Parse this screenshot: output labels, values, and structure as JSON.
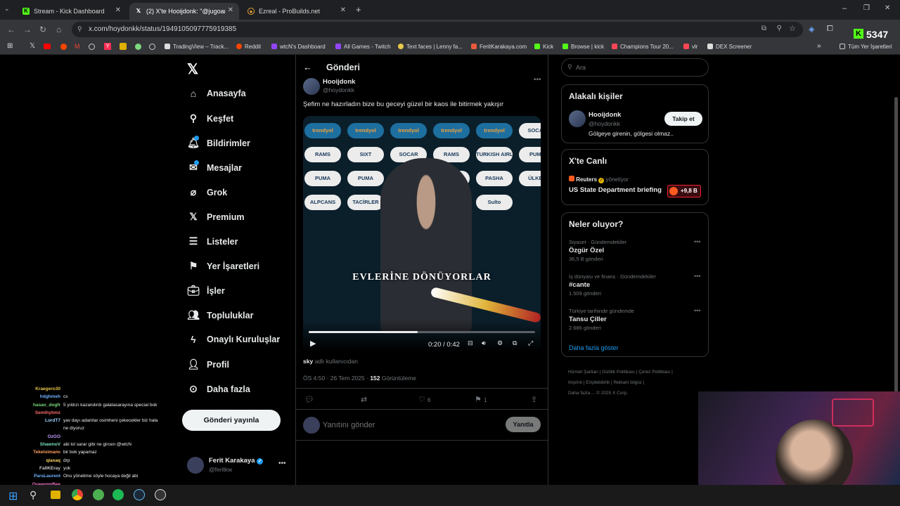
{
  "browser": {
    "tabs": [
      {
        "title": "Stream - Kick Dashboard",
        "icon": "kick-icon",
        "color": "#53fc18"
      },
      {
        "title": "(2) X'te Hooijdonk: \"@jugoarda",
        "icon": "x-logo-icon",
        "color": "#ffffff"
      },
      {
        "title": "Ezreal - ProBuilds.net",
        "icon": "probuilds-icon",
        "color": "#e8a33b"
      }
    ],
    "url": "x.com/hoydonkk/status/1949105097775919385",
    "bookmarks": [
      "TradingView – Track...",
      "Reddit",
      "wtcN's Dashboard",
      "All Games - Twitch",
      "Text faces | Lenny fa...",
      "FeritKarakaya.com",
      "Kick",
      "Browse | kick",
      "Champions Tour 20...",
      "vlr",
      "DEX Screener"
    ],
    "all_bookmarks": "Tüm Yer İşaretleri",
    "kick_counter": "5347"
  },
  "nav": {
    "items": [
      "Anasayfa",
      "Keşfet",
      "Bildirimler",
      "Mesajlar",
      "Grok",
      "Premium",
      "Listeler",
      "Yer İşaretleri",
      "İşler",
      "Topluluklar",
      "Onaylı Kuruluşlar",
      "Profil",
      "Daha fazla"
    ],
    "post_button": "Gönderi yayınla",
    "account_name": "Ferit Karakaya",
    "account_handle": "@feritkw"
  },
  "post": {
    "header": "Gönderi",
    "author_name": "Hooijdonk",
    "author_handle": "@hoydonkk",
    "text": "Şefim ne hazırladın bize bu geceyi güzel bir kaos ile bitirmek yakışır",
    "video_caption": "EVLERİNE DÖNÜYORLAR",
    "video_time": "0:20 / 0:42",
    "video_progress": 0.48,
    "sponsors": [
      "trendyol",
      "trendyol",
      "trendyol",
      "trendyol",
      "trendyol",
      "SOCAR",
      "RAMS",
      "SIXT",
      "SOCAR",
      "RAMS",
      "TURKISH AIRLINES",
      "PUMA",
      "PUMA",
      "PUMA",
      "PASIF",
      "ÜLKER",
      "PASHA",
      "ÜLKER",
      "ALPCANS",
      "TACİRLER",
      "PASHA",
      "PASIF",
      "Sulto"
    ],
    "attribution_user": "sky",
    "attribution_suffix": "adlı kullanıcıdan",
    "timestamp": "ÖS 4:50 · 26 Tem 2025 ·",
    "views_count": "152",
    "views_label": "Görüntüleme",
    "likes": "6",
    "bookmarks": "1",
    "reply_placeholder": "Yanıtını gönder",
    "reply_button": "Yanıtla"
  },
  "sidebar": {
    "search_placeholder": "Ara",
    "related_title": "Alakalı kişiler",
    "related_name": "Hooijdonk",
    "related_handle": "@hoydonkk",
    "related_bio": "Gölgeye girenin, gölgesi olmaz..",
    "follow_button": "Takip et",
    "live_title": "X'te Canlı",
    "live_source": "Reuters",
    "live_status": "yönetiyor",
    "live_event": "US State Department briefing",
    "live_count": "+9,8 B",
    "trends_title": "Neler oluyor?",
    "trends": [
      {
        "category": "Siyaset · Gündemdekiler",
        "name": "Özgür Özel",
        "count": "36,5 B gönderi"
      },
      {
        "category": "İş dünyası ve finans · Gündemdekiler",
        "name": "#cante",
        "count": "1.509 gönderi"
      },
      {
        "category": "Türkiye tarihinde gündemde",
        "name": "Tansu Çiller",
        "count": "2.686 gönderi"
      }
    ],
    "show_more": "Daha fazla göster",
    "footer_links": [
      "Hizmet Şartları",
      "Gizlilik Politikası",
      "Çerez Politikası",
      "Imprint",
      "Erişilebilirlik",
      "Reklam bilgisi",
      "Daha fazla ...",
      "© 2025 X Corp."
    ]
  },
  "chat": [
    {
      "user": "Kraegero30",
      "msg": "",
      "color": "#e8c84a"
    },
    {
      "user": "hdghmeh",
      "msg": "cs",
      "color": "#6fb3ff"
    },
    {
      "user": "hasan_dogfr",
      "msg": "5 yıldızı kazandırdı galatasarayına special bok",
      "color": "#7cd97c"
    },
    {
      "user": "Semihybmz",
      "msg": "",
      "color": "#ff6b6b"
    },
    {
      "user": "LordT7",
      "msg": "yav dayı adamlar osimheni çekecekler biz hala",
      "color": "#9fd3ff"
    },
    {
      "user": "",
      "msg": "ne diyoruz",
      "color": "#9fd3ff"
    },
    {
      "user": "OzGO",
      "msg": "",
      "color": "#c29cff"
    },
    {
      "user": "ShawnoV",
      "msg": "abi lol sarar gibi ne gircen @wtcN",
      "color": "#79e0c0"
    },
    {
      "user": "Tekeloimamı",
      "msg": "bir bok yapamaz",
      "color": "#ff9e5e"
    },
    {
      "user": "qiaxaq",
      "msg": "drp",
      "color": "#ffd75e"
    },
    {
      "user": "FallKEray",
      "msg": "yok",
      "color": "#c7c7c7"
    },
    {
      "user": "ParsLaurent",
      "msg": "Onu yönetime söyle hocaya değil abi",
      "color": "#6fb3ff"
    },
    {
      "user": "QueennnBee",
      "msg": "",
      "color": "#ff7ad1"
    },
    {
      "user": "Cloefhoigh",
      "msg": "YARRAAA KANO!",
      "color": "#e8c84a"
    },
    {
      "user": "Enihic",
      "msg": "PeepoFinger",
      "color": "#c7c7c7"
    }
  ]
}
